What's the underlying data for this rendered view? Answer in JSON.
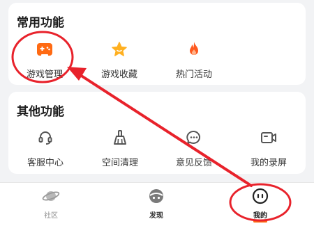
{
  "common": {
    "title": "常用功能",
    "items": [
      {
        "label": "游戏管理",
        "icon": "gamepad-icon"
      },
      {
        "label": "游戏收藏",
        "icon": "star-icon"
      },
      {
        "label": "热门活动",
        "icon": "flame-icon"
      }
    ]
  },
  "other": {
    "title": "其他功能",
    "items": [
      {
        "label": "客服中心",
        "icon": "headset-icon"
      },
      {
        "label": "空间清理",
        "icon": "broom-icon"
      },
      {
        "label": "意见反馈",
        "icon": "chat-bubble-icon"
      },
      {
        "label": "我的录屏",
        "icon": "video-camera-icon"
      }
    ]
  },
  "tabbar": {
    "items": [
      {
        "label": "社区",
        "icon": "planet-icon",
        "active": false
      },
      {
        "label": "发现",
        "icon": "discover-icon",
        "active": false
      },
      {
        "label": "我的",
        "icon": "face-icon",
        "active": true
      }
    ]
  },
  "colors": {
    "accent": "#ff6a13",
    "annotation": "#e8222b",
    "icon_gray": "#555555"
  }
}
